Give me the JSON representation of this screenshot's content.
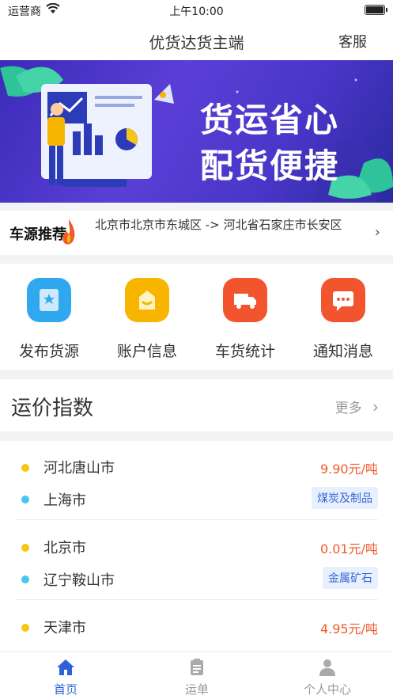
{
  "status_bar": {
    "carrier": "运营商",
    "time": "上午10:00"
  },
  "nav": {
    "title": "优货达货主端",
    "service": "客服"
  },
  "banner": {
    "line1": "货运省心",
    "line2": "配货便捷"
  },
  "recommend": {
    "tag": "车源推荐",
    "route": "北京市北京市东城区 -> 河北省石家庄市长安区"
  },
  "menu": [
    {
      "label": "发布货源",
      "icon": "publish-icon",
      "color": "#2fa8ef"
    },
    {
      "label": "账户信息",
      "icon": "account-icon",
      "color": "#f7b500"
    },
    {
      "label": "车货统计",
      "icon": "truck-icon",
      "color": "#f2542d"
    },
    {
      "label": "通知消息",
      "icon": "message-icon",
      "color": "#f2542d"
    }
  ],
  "freight": {
    "title": "运价指数",
    "more": "更多"
  },
  "rows": [
    {
      "from": "河北唐山市",
      "to": "上海市",
      "price": "9.90元/吨",
      "cargo": "煤炭及制品"
    },
    {
      "from": "北京市",
      "to": "辽宁鞍山市",
      "price": "0.01元/吨",
      "cargo": "金属矿石"
    },
    {
      "from": "天津市",
      "to": "",
      "price": "4.95元/吨",
      "cargo": ""
    }
  ],
  "tabs": [
    {
      "label": "首页",
      "icon": "home-icon"
    },
    {
      "label": "运单",
      "icon": "waybill-icon"
    },
    {
      "label": "个人中心",
      "icon": "person-icon"
    }
  ],
  "colors": {
    "accent": "#2f62d8",
    "price": "#f05a28",
    "banner": "#4a36c9"
  }
}
